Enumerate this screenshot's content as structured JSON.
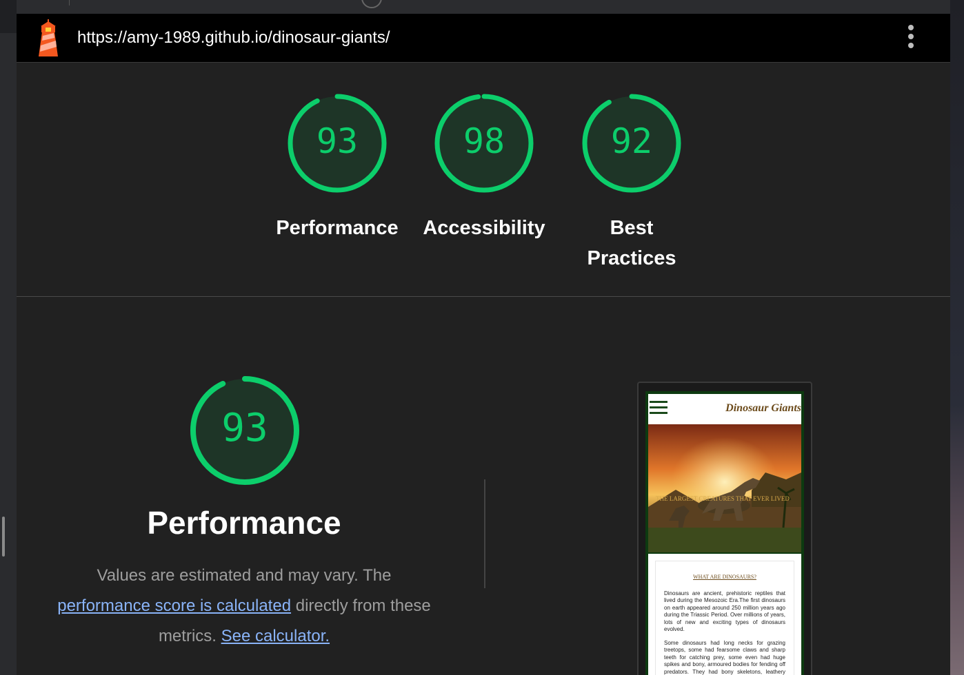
{
  "header": {
    "url": "https://amy-1989.github.io/dinosaur-giants/"
  },
  "scores": [
    {
      "label": "Performance",
      "score": 93,
      "fraction": 0.93
    },
    {
      "label": "Accessibility",
      "score": 98,
      "fraction": 0.98
    },
    {
      "label": "Best Practices",
      "score": 92,
      "fraction": 0.92
    }
  ],
  "performance": {
    "score": 93,
    "fraction": 0.93,
    "title": "Performance",
    "desc_1": "Values are estimated and may vary. The",
    "link_score": "performance score is calculated",
    "desc_2": " directly from these metrics.",
    "link_calc": "See calculator."
  },
  "screenshot": {
    "site_title": "Dinosaur Giants",
    "hero_caption": "THE LARGEST CREATURES THAT EVER LIVED",
    "section_heading": "WHAT ARE DINOSAURS?",
    "para_1": "Dinosaurs are ancient, prehistoric reptiles that lived during the Mesozoic Era.The first dinosaurs on earth appeared around 250 million years ago during the Triassic Period. Over millions of years, lots of new and exciting types of dinosaurs evolved.",
    "para_2": "Some dinosaurs had long necks for grazing treetops, some had fearsome claws and sharp teeth for catching prey, some even had huge spikes and bony, armoured bodies for fending off predators. They had bony skeletons, leathery skin and, in some"
  },
  "colors": {
    "pass": "#0cce6b",
    "pass_fill": "#1e3527",
    "link": "#8ab4f8",
    "background": "#212121"
  },
  "icons": [
    "lighthouse-logo-icon",
    "more-vert-icon",
    "hamburger-menu-icon"
  ]
}
